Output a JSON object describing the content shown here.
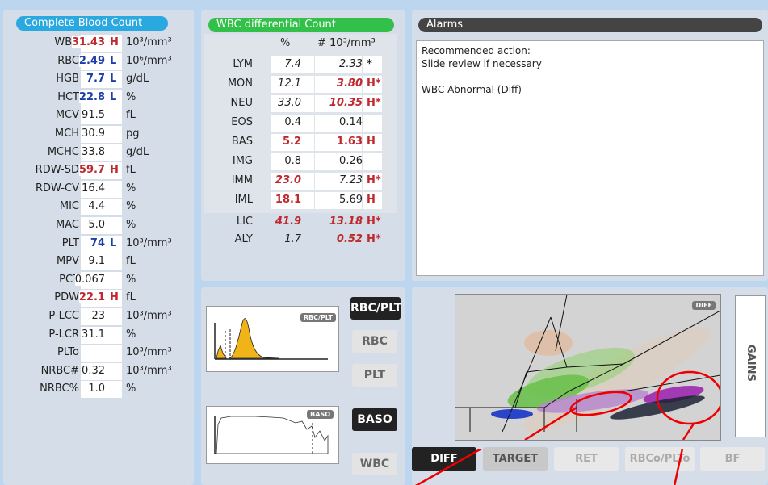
{
  "cbc": {
    "title": "Complete Blood Count",
    "rows": [
      {
        "name": "WBC",
        "value": "31.43",
        "flag": "H",
        "unit": "10³/mm³",
        "state": "hi"
      },
      {
        "name": "RBC",
        "value": "2.49",
        "flag": "L",
        "unit": "10⁶/mm³",
        "state": "lo"
      },
      {
        "name": "HGB",
        "value": "7.7",
        "flag": "L",
        "unit": "g/dL",
        "state": "lo"
      },
      {
        "name": "HCT",
        "value": "22.8",
        "flag": "L",
        "unit": "%",
        "state": "lo"
      },
      {
        "name": "MCV",
        "value": "91.5",
        "flag": "",
        "unit": "fL",
        "state": ""
      },
      {
        "name": "MCH",
        "value": "30.9",
        "flag": "",
        "unit": "pg",
        "state": ""
      },
      {
        "name": "MCHC",
        "value": "33.8",
        "flag": "",
        "unit": "g/dL",
        "state": ""
      },
      {
        "name": "RDW-SD",
        "value": "59.7",
        "flag": "H",
        "unit": "fL",
        "state": "hi"
      },
      {
        "name": "RDW-CV",
        "value": "16.4",
        "flag": "",
        "unit": "%",
        "state": ""
      },
      {
        "name": "MIC",
        "value": "4.4",
        "flag": "",
        "unit": "%",
        "state": ""
      },
      {
        "name": "MAC",
        "value": "5.0",
        "flag": "",
        "unit": "%",
        "state": ""
      },
      {
        "name": "PLT",
        "value": "74",
        "flag": "L",
        "unit": "10³/mm³",
        "state": "lo"
      },
      {
        "name": "MPV",
        "value": "9.1",
        "flag": "",
        "unit": "fL",
        "state": ""
      },
      {
        "name": "PCT",
        "value": "0.067",
        "flag": "",
        "unit": "%",
        "state": ""
      },
      {
        "name": "PDW",
        "value": "22.1",
        "flag": "H",
        "unit": "fL",
        "state": "hi"
      },
      {
        "name": "P-LCC",
        "value": "23",
        "flag": "",
        "unit": "10³/mm³",
        "state": ""
      },
      {
        "name": "P-LCR",
        "value": "31.1",
        "flag": "",
        "unit": "%",
        "state": ""
      },
      {
        "name": "PLTo",
        "value": "",
        "flag": "",
        "unit": "10³/mm³",
        "state": ""
      },
      {
        "name": "NRBC#",
        "value": "0.32",
        "flag": "",
        "unit": "10³/mm³",
        "state": ""
      },
      {
        "name": "NRBC%",
        "value": "1.0",
        "flag": "",
        "unit": "%",
        "state": ""
      }
    ]
  },
  "diff": {
    "title": "WBC differential Count",
    "col_pct": "%",
    "col_abs": "# 10³/mm³",
    "rows": [
      {
        "name": "LYM",
        "pct": "7.4",
        "abs": "2.33",
        "flag": "*",
        "pct_state": "",
        "abs_state": ""
      },
      {
        "name": "MON",
        "pct": "12.1",
        "abs": "3.80",
        "flag": "H*",
        "pct_state": "",
        "abs_state": "hi"
      },
      {
        "name": "NEU",
        "pct": "33.0",
        "abs": "10.35",
        "flag": "H*",
        "pct_state": "",
        "abs_state": "hi"
      },
      {
        "name": "EOS",
        "pct": "0.4",
        "abs": "0.14",
        "flag": "",
        "pct_state": "plain",
        "abs_state": "plain"
      },
      {
        "name": "BAS",
        "pct": "5.2",
        "abs": "1.63",
        "flag": "H",
        "pct_state": "hi",
        "abs_state": "hi"
      },
      {
        "name": "IMG",
        "pct": "0.8",
        "abs": "0.26",
        "flag": "",
        "pct_state": "plain",
        "abs_state": "plain"
      },
      {
        "name": "IMM",
        "pct": "23.0",
        "abs": "7.23",
        "flag": "H*",
        "pct_state": "hi",
        "abs_state": ""
      },
      {
        "name": "IML",
        "pct": "18.1",
        "abs": "5.69",
        "flag": "H",
        "pct_state": "hi",
        "abs_state": "plain"
      },
      {
        "name": "LIC",
        "pct": "41.9",
        "abs": "13.18",
        "flag": "H*",
        "pct_state": "hi",
        "abs_state": "hi"
      },
      {
        "name": "ALY",
        "pct": "1.7",
        "abs": "0.52",
        "flag": "H*",
        "pct_state": "",
        "abs_state": "hi"
      }
    ]
  },
  "alarms": {
    "title": "Alarms",
    "lines": [
      "Recommended action:",
      "Slide review if necessary",
      "-----------------",
      "WBC Abnormal (Diff)"
    ]
  },
  "histograms": {
    "rbcplt_tag": "RBC/PLT",
    "baso_tag": "BASO",
    "buttons": {
      "rbc_plt": "RBC/PLT",
      "rbc": "RBC",
      "plt": "PLT",
      "baso": "BASO",
      "wbc": "WBC"
    }
  },
  "scatter": {
    "tag": "DIFF",
    "gains": "GAINS",
    "tabs": [
      "DIFF",
      "TARGET",
      "RET",
      "RBCo/PLTo",
      "BF"
    ]
  },
  "colors": {
    "accent_blue": "#2aa8e0",
    "accent_green": "#33c04a",
    "high": "#c0282d",
    "low": "#1d3ea8"
  }
}
